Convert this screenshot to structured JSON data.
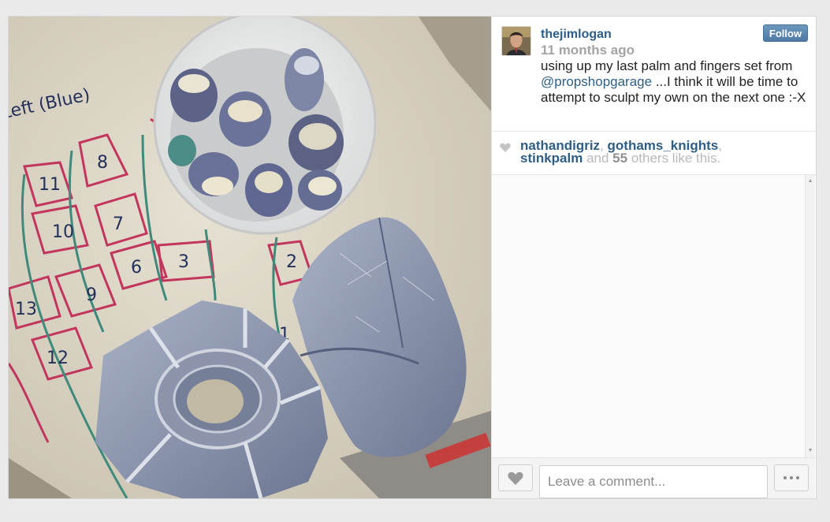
{
  "post": {
    "username": "thejimlogan",
    "time_ago": "11 months ago",
    "follow_label": "Follow",
    "caption_pre": "using up my last palm and fingers set from ",
    "caption_mention": "@propshopgarage",
    "caption_post": " ...I think it will be time to attempt to sculpt my own on the next one :-X"
  },
  "likes": {
    "user1": "nathandigriz",
    "sep1": ", ",
    "user2": "gothams_knights",
    "sep2": ",",
    "user3": "stinkpalm",
    "and_text": " and ",
    "count": "55",
    "suffix": " others like this."
  },
  "comment": {
    "placeholder": "Leave a comment..."
  },
  "photo": {
    "handwriting": {
      "left_blue": "Left (Blue)",
      "n11": "11",
      "n10": "10",
      "n8": "8",
      "n7": "7",
      "n6": "6",
      "n3": "3",
      "n2": "2",
      "n9": "9",
      "n13": "13",
      "n12": "12",
      "n1": "1"
    }
  },
  "colors": {
    "link": "#2e5e86",
    "follow_button": "#5a86ae",
    "muted": "#a4a4a4"
  },
  "icons": {
    "like_small": "heart-icon",
    "like_button": "heart-icon",
    "more": "ellipsis-icon"
  }
}
